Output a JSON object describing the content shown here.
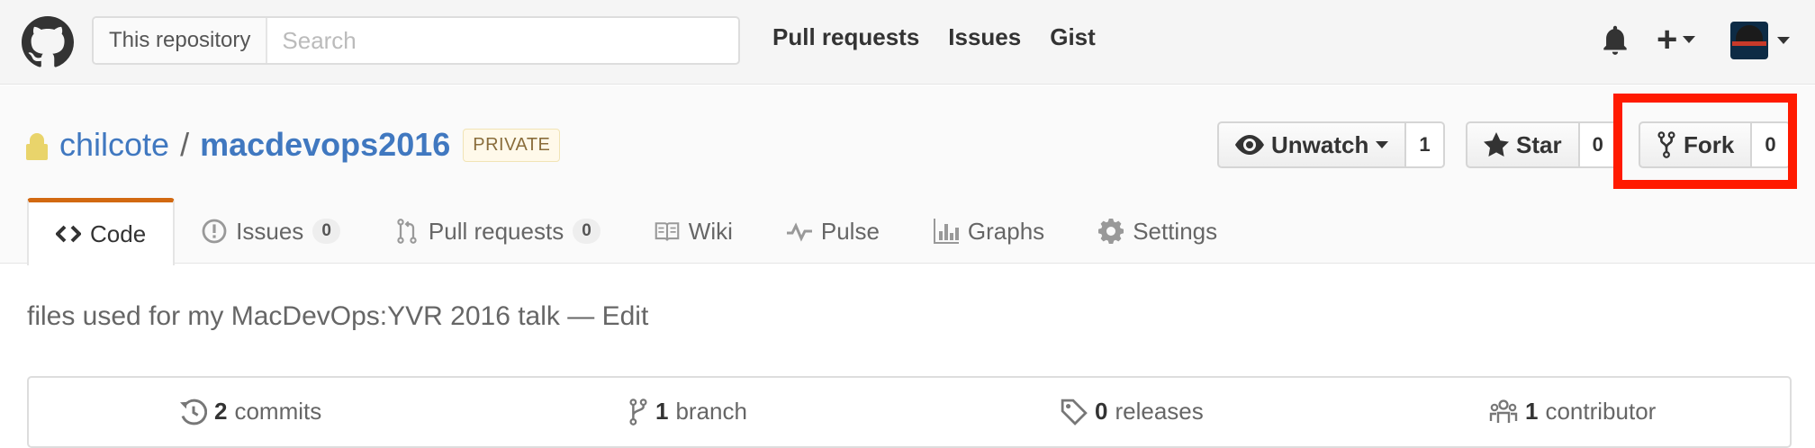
{
  "header": {
    "search_scope": "This repository",
    "search_placeholder": "Search",
    "nav": [
      "Pull requests",
      "Issues",
      "Gist"
    ]
  },
  "repo": {
    "owner": "chilcote",
    "separator": "/",
    "name": "macdevops2016",
    "visibility": "PRIVATE",
    "actions": {
      "watch": {
        "label": "Unwatch",
        "count": "1"
      },
      "star": {
        "label": "Star",
        "count": "0"
      },
      "fork": {
        "label": "Fork",
        "count": "0"
      }
    }
  },
  "tabs": [
    {
      "label": "Code",
      "icon": "code-icon",
      "selected": true
    },
    {
      "label": "Issues",
      "icon": "issue-icon",
      "counter": "0"
    },
    {
      "label": "Pull requests",
      "icon": "pull-request-icon",
      "counter": "0"
    },
    {
      "label": "Wiki",
      "icon": "book-icon"
    },
    {
      "label": "Pulse",
      "icon": "pulse-icon"
    },
    {
      "label": "Graphs",
      "icon": "graph-icon"
    },
    {
      "label": "Settings",
      "icon": "gear-icon"
    }
  ],
  "description": {
    "text": "files used for my MacDevOps:YVR 2016 talk",
    "dash": "—",
    "edit": "Edit"
  },
  "summary": {
    "commits": {
      "count": "2",
      "label": "commits"
    },
    "branches": {
      "count": "1",
      "label": "branch"
    },
    "releases": {
      "count": "0",
      "label": "releases"
    },
    "contributors": {
      "count": "1",
      "label": "contributor"
    }
  },
  "colors": {
    "accent_link": "#4078c0",
    "selected_tab_border": "#d26911",
    "highlight": "#ff1a00"
  }
}
